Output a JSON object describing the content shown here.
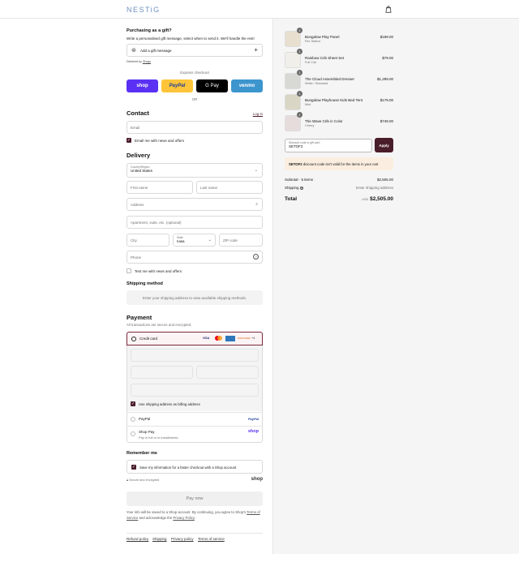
{
  "brand": {
    "name": "NESTiG"
  },
  "gift": {
    "title": "Purchasing as a gift?",
    "desc": "Write a personalised gift message, select when to send it. We'll handle the rest!",
    "add_label": "Add a gift message",
    "delivered_by": "Delivered by",
    "delivered_by_link": "Ghogo"
  },
  "express": {
    "title": "Express checkout",
    "shop": "shop",
    "paypal": "PayPal",
    "gpay": "G Pay",
    "venmo": "venmo",
    "or": "OR"
  },
  "contact": {
    "title": "Contact",
    "login": "Log in",
    "email_placeholder": "Email",
    "news_label": "Email me with news and offers"
  },
  "delivery": {
    "title": "Delivery",
    "country_label": "Country/Region",
    "country_value": "United States",
    "first_name": "First name",
    "last_name": "Last name",
    "address": "Address",
    "apartment": "Apartment, suite, etc. (optional)",
    "city": "City",
    "state_label": "State",
    "state_value": "Iowa",
    "zip": "ZIP code",
    "phone": "Phone",
    "text_label": "Text me with news and offers"
  },
  "shipping": {
    "title": "Shipping method",
    "note": "Enter your shipping address to view available shipping methods."
  },
  "payment": {
    "title": "Payment",
    "subtitle": "All transactions are secure and encrypted.",
    "credit_card": "Credit card",
    "billing_label": "Use shipping address as billing address",
    "paypal_label": "PayPal",
    "shoppay_label": "Shop Pay",
    "shoppay_sub": "Pay in full or in installments",
    "shop_logo": "shop",
    "paypal_logo": "PayPal",
    "card_brands": [
      "VISA",
      "MC",
      "AMEX",
      "DISCOVER",
      "+4"
    ]
  },
  "remember": {
    "title": "Remember me",
    "label": "Save my information for a faster checkout with a Shop account",
    "secure": "Secure and encrypted",
    "shop": "shop"
  },
  "pay_button": "Pay now",
  "disclaimer": {
    "text1": "Your info will be saved to a Shop account. By continuing, you agree to Shop's",
    "tos": "Terms of Service",
    "text2": "and acknowledge the",
    "privacy": "Privacy Policy",
    "end": "."
  },
  "footer": {
    "refund": "Refund policy",
    "shipping": "Shipping",
    "privacy": "Privacy policy",
    "terms": "Terms of service"
  },
  "cart": {
    "items": [
      {
        "name": "Bungalow Play Panel",
        "variant": "Fire Station",
        "price": "$199.00",
        "qty": "1"
      },
      {
        "name": "Rainbow Crib Sheet Set",
        "variant": "Full Crib",
        "price": "$79.00",
        "qty": "1"
      },
      {
        "name": "The Cloud Assembled Dresser",
        "variant": "White / Standard",
        "price": "$1,299.00",
        "qty": "1"
      },
      {
        "name": "Bungalow Playhouse Kids Bed Tent",
        "variant": "Mint",
        "price": "$179.00",
        "qty": "1"
      },
      {
        "name": "The Wave Crib in Color",
        "variant": "Cherry",
        "price": "$749.00",
        "qty": "1"
      }
    ],
    "discount_label": "Discount code or gift card",
    "discount_value": "SETOF2",
    "apply": "Apply",
    "error_code": "SETOF2",
    "error_msg": "discount code isn't valid for the items in your cart",
    "subtotal_label": "Subtotal · 5 items",
    "subtotal": "$2,505.00",
    "shipping_label": "Shipping",
    "shipping_value": "Enter shipping address",
    "total_label": "Total",
    "currency": "USD",
    "total": "$2,505.00"
  }
}
